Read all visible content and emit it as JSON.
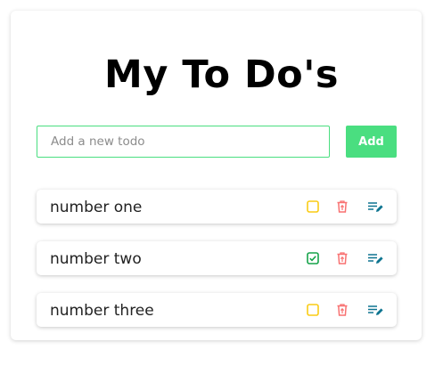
{
  "header": {
    "title": "My To Do's"
  },
  "form": {
    "input_placeholder": "Add a new todo",
    "input_value": "",
    "add_label": "Add"
  },
  "todos": [
    {
      "text": "number one",
      "completed": false
    },
    {
      "text": "number two",
      "completed": true
    },
    {
      "text": "number three",
      "completed": false
    }
  ],
  "icons": {
    "checkbox": "checkbox-icon",
    "checked": "checkbox-checked-icon",
    "delete": "trash-icon",
    "edit": "edit-icon"
  },
  "colors": {
    "accent": "#4ade80",
    "checkbox_unchecked": "#facc15",
    "checkbox_checked": "#16a34a",
    "delete": "#f87171",
    "edit": "#0e7490"
  }
}
